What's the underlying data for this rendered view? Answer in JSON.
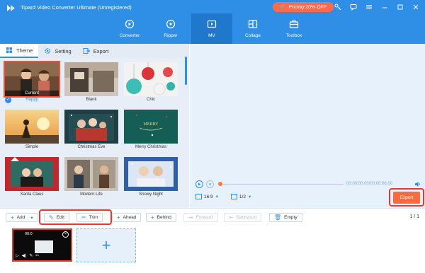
{
  "window": {
    "title": "Tipard Video Converter Ultimate (Unregistered)",
    "promo_label": "Pricing-20% OFF"
  },
  "nav": {
    "items": [
      {
        "label": "Converter",
        "icon": "converter-icon"
      },
      {
        "label": "Ripper",
        "icon": "ripper-icon"
      },
      {
        "label": "MV",
        "icon": "mv-icon",
        "active": true
      },
      {
        "label": "Collage",
        "icon": "collage-icon"
      },
      {
        "label": "Toolbox",
        "icon": "toolbox-icon"
      }
    ]
  },
  "tabs": {
    "theme": "Theme",
    "setting": "Setting",
    "export": "Export"
  },
  "themes": [
    {
      "label": "Happy",
      "selected": true,
      "tag": "Current"
    },
    {
      "label": "Blank"
    },
    {
      "label": "Chic"
    },
    {
      "label": "Simple"
    },
    {
      "label": "Christmas Eve"
    },
    {
      "label": "Merry Christmas"
    },
    {
      "label": "Santa Claus"
    },
    {
      "label": "Modern Life"
    },
    {
      "label": "Snowy Night"
    }
  ],
  "preview": {
    "time": "00:00:00.00/00:00:06.00",
    "ratio": "16:9",
    "page": "1/2",
    "export_label": "Export"
  },
  "toolbar": {
    "add": "Add",
    "edit": "Edit",
    "trim": "Trim",
    "ahead": "Ahead",
    "behind": "Behind",
    "forward": "Forward",
    "backward": "Backward",
    "empty": "Empty",
    "pager": "1 / 1"
  },
  "timeline": {
    "clip_time": "00:0"
  },
  "colors": {
    "brand": "#2f8ee5",
    "export": "#ff6a3d",
    "highlight": "#e53935"
  }
}
